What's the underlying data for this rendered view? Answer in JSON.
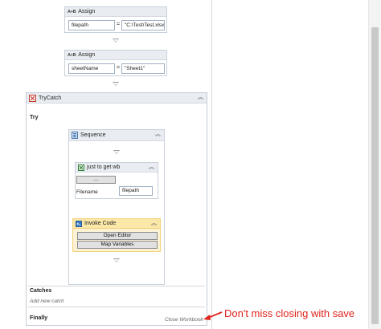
{
  "assign1": {
    "title": "Assign",
    "to": "filepath",
    "eq": "=",
    "value": "\"C:\\Test\\Test.xlsx\""
  },
  "assign2": {
    "title": "Assign",
    "to": "sheetName",
    "eq": "=",
    "value": "\"Sheet1\""
  },
  "trycatch": {
    "title": "TryCatch",
    "try_label": "Try",
    "catches_label": "Catches",
    "add_catch": "Add new catch",
    "finally_label": "Finally",
    "finally_value": "Close Workbook"
  },
  "sequence": {
    "title": "Sequence"
  },
  "getwb": {
    "title": "just to get wb",
    "button": "...",
    "filename_label": "Filename",
    "filename_value": "filepath"
  },
  "invoke": {
    "title": "Invoke Code",
    "open_editor": "Open Editor",
    "map_variables": "Map Variables"
  },
  "annotation": {
    "text": "Don't miss closing with save",
    "color": "#e0241d"
  },
  "icons": {
    "assign": "ab-assign-icon",
    "trycatch": "trycatch-icon",
    "sequence": "sequence-icon",
    "workbook": "excel-workbook-icon",
    "invoke": "invoke-code-icon",
    "collapse": "chevron-up-double-icon"
  },
  "colors": {
    "header_bg": "#e9edf2",
    "invoke_bg": "#fdf3d4",
    "invoke_border": "#f2d27a",
    "annotation": "#e0241d"
  }
}
